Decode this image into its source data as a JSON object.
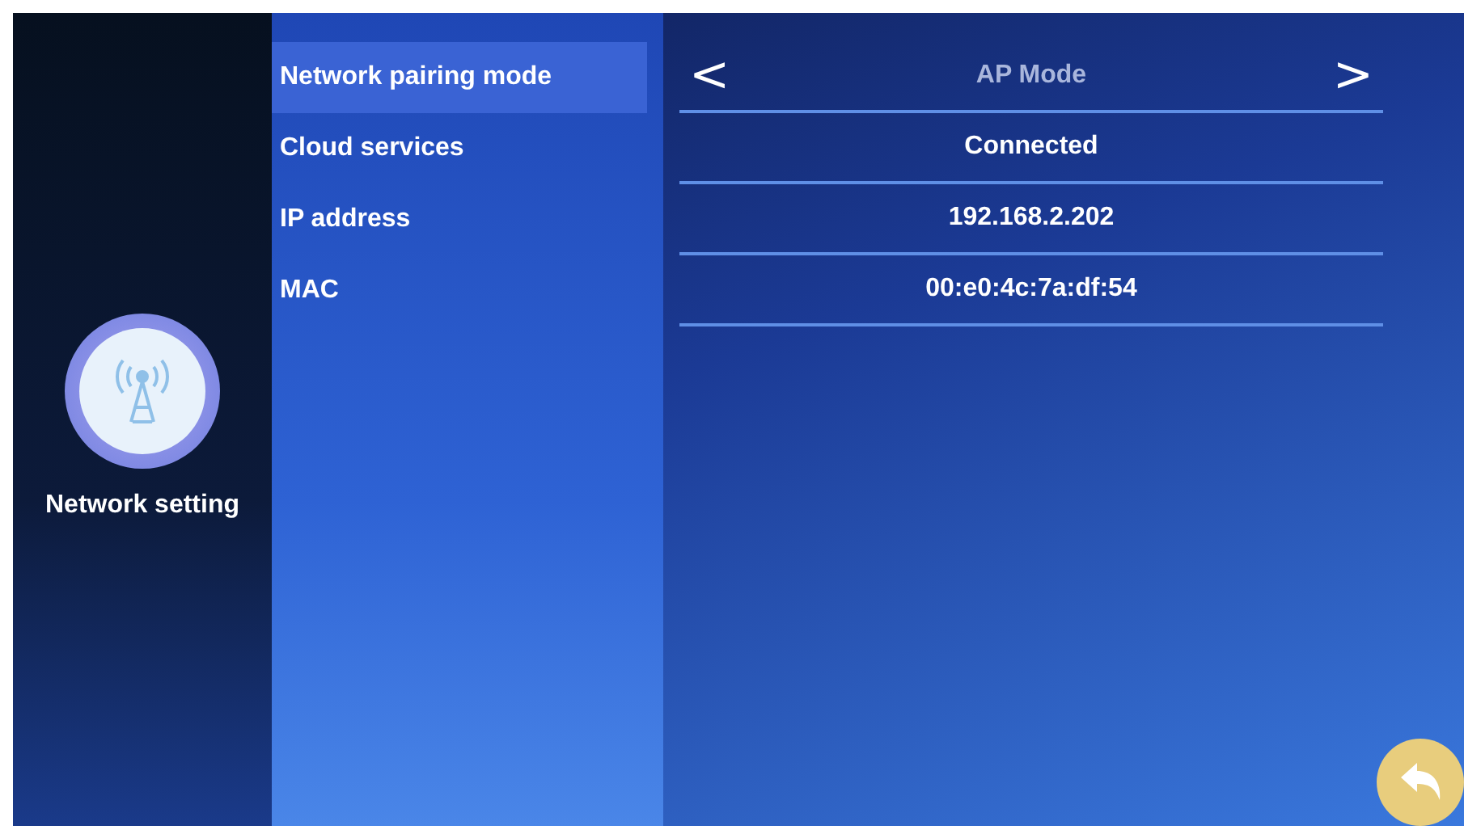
{
  "sidebar": {
    "label": "Network setting"
  },
  "rows": [
    {
      "label": "Network pairing mode",
      "selected": true,
      "kind": "selector",
      "value": "AP Mode",
      "prev": "<",
      "next": ">"
    },
    {
      "label": "Cloud services",
      "selected": false,
      "kind": "text",
      "value": "Connected"
    },
    {
      "label": "IP address",
      "selected": false,
      "kind": "text",
      "value": "192.168.2.202"
    },
    {
      "label": "MAC",
      "selected": false,
      "kind": "text",
      "value": "00:e0:4c:7a:df:54"
    }
  ]
}
